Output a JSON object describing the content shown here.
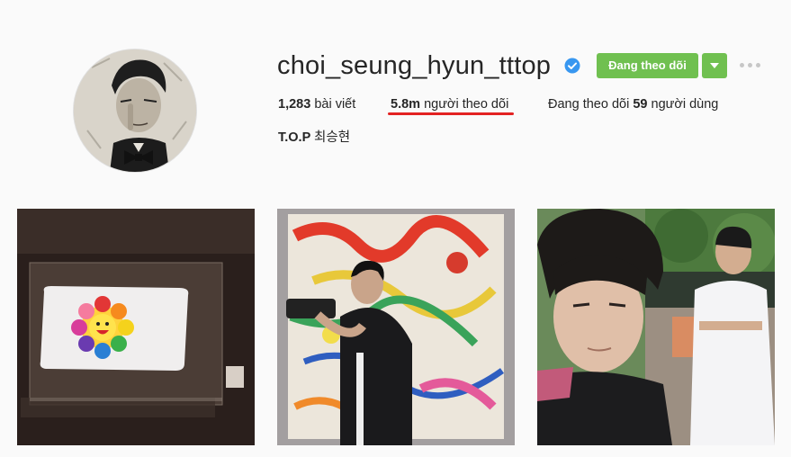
{
  "profile": {
    "username": "choi_seung_hyun_tttop",
    "verified": true,
    "avatar_icon": "profile-photo",
    "follow_button_label": "Đang theo dõi",
    "stats": {
      "posts_count": "1,283",
      "posts_label": "bài viết",
      "followers_count": "5.8m",
      "followers_label": "người theo dõi",
      "following_prefix": "Đang theo dõi",
      "following_count": "59",
      "following_suffix": "người dùng"
    },
    "full_name": "T.O.P",
    "full_name_korean": "최승현"
  },
  "colors": {
    "follow_button": "#70c050",
    "verified_badge": "#3897f0",
    "highlight_underline": "#e32222"
  },
  "posts": [
    {
      "description_icon": "pillow-flower-photo"
    },
    {
      "description_icon": "selfie-painting-photo"
    },
    {
      "description_icon": "selfie-outdoor-photo"
    }
  ]
}
